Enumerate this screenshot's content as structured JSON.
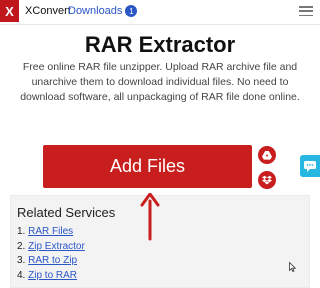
{
  "nav": {
    "logo_letter": "X",
    "brand": "XConvert",
    "downloads_label": "Downloads",
    "downloads_count": "1"
  },
  "main": {
    "title": "RAR Extractor",
    "description": "Free online RAR file unzipper. Upload RAR archive file and unarchive them to download individual files. No need to download software, all unpackaging of RAR file done online.",
    "add_files_label": "Add Files"
  },
  "related": {
    "heading": "Related Services",
    "items": [
      {
        "num": "1.",
        "label": "RAR Files"
      },
      {
        "num": "2.",
        "label": "Zip Extractor"
      },
      {
        "num": "3.",
        "label": "RAR to Zip"
      },
      {
        "num": "4.",
        "label": "Zip to RAR"
      }
    ]
  },
  "colors": {
    "brand_red": "#c81e1e",
    "link_blue": "#2a56c6",
    "chat_cyan": "#27b7e0"
  },
  "icons": [
    "menu-icon",
    "google-drive-icon",
    "dropbox-icon",
    "chat-icon",
    "annotation-arrow-icon",
    "mouse-cursor-icon"
  ]
}
